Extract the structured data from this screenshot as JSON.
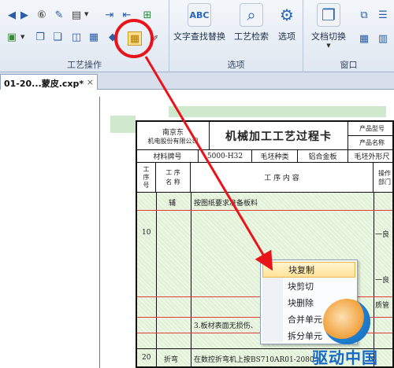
{
  "ribbon": {
    "groups": [
      {
        "label": "工艺操作"
      },
      {
        "label": "选项"
      },
      {
        "label": "窗口"
      }
    ],
    "big_buttons": [
      {
        "label": "文字查找替换",
        "icon": "abc-find-icon"
      },
      {
        "label": "工艺检索",
        "icon": "magnifier-doc-icon"
      },
      {
        "label": "选项",
        "icon": "gear-icon"
      },
      {
        "label": "文档切换",
        "icon": "doc-switch-icon"
      }
    ]
  },
  "tab": {
    "label": "01-20...蒙皮.cxp*",
    "close": "×"
  },
  "sheet": {
    "company_line1": "南京东 ",
    "company_line2": "机电股份有限公司",
    "title": "机械加工工艺过程卡",
    "product_model": "产品型号",
    "product_name": "产品名称",
    "material_label": "材料牌号",
    "material_value": "5000-H32",
    "blank_type": "毛坯种类",
    "blank_value": "铝合金板",
    "blank_shape": "毛坯外形尺",
    "col_seq": "工\n序\n号",
    "col_name": "工 序\n名 称",
    "col_content": "工  序  内  容",
    "col_dept": "操作\n部门",
    "row1_name": "辅",
    "row1_text": "按图纸要求准备板料",
    "row2_seq": "10",
    "row2_dept": "一良",
    "row3_dept": "一良",
    "row4_dept": "质管",
    "row5_text": "3.板材表面无损伤、",
    "row6_seq": "20",
    "row6_name": "折弯",
    "row6_text": "在数控折弯机上按BS710AR01-2080"
  },
  "context_menu": {
    "items": [
      {
        "label": "块复制",
        "highlighted": true
      },
      {
        "label": "块剪切",
        "highlighted": false
      },
      {
        "label": "块删除",
        "highlighted": false
      },
      {
        "label": "合并单元",
        "highlighted": false
      },
      {
        "label": "拆分单元",
        "highlighted": false
      }
    ]
  },
  "watermark": {
    "text": "驱动中国"
  },
  "colors": {
    "annotation_red": "#e8141a",
    "menu_highlight": "#ffe39a",
    "brand_blue": "#1768c2"
  }
}
